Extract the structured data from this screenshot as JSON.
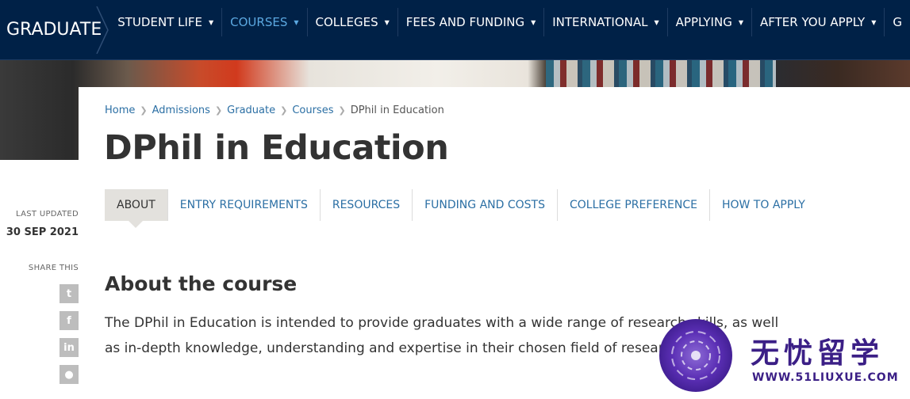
{
  "header": {
    "brand": "GRADUATE",
    "nav": [
      {
        "label": "STUDENT LIFE",
        "active": false
      },
      {
        "label": "COURSES",
        "active": true
      },
      {
        "label": "COLLEGES",
        "active": false
      },
      {
        "label": "FEES AND FUNDING",
        "active": false
      },
      {
        "label": "INTERNATIONAL",
        "active": false
      },
      {
        "label": "APPLYING",
        "active": false
      },
      {
        "label": "AFTER YOU APPLY",
        "active": false
      },
      {
        "label": "G",
        "active": false
      }
    ],
    "caret": "▼",
    "colors": {
      "background": "#002147",
      "active": "#5ba8e0"
    }
  },
  "breadcrumb": {
    "items": [
      "Home",
      "Admissions",
      "Graduate",
      "Courses"
    ],
    "current": "DPhil in Education",
    "separator": "❯"
  },
  "page_title": "DPhil in Education",
  "tabs": [
    {
      "label": "ABOUT",
      "active": true
    },
    {
      "label": "ENTRY REQUIREMENTS",
      "active": false
    },
    {
      "label": "RESOURCES",
      "active": false
    },
    {
      "label": "FUNDING AND COSTS",
      "active": false
    },
    {
      "label": "COLLEGE PREFERENCE",
      "active": false
    },
    {
      "label": "HOW TO APPLY",
      "active": false
    }
  ],
  "sidebar": {
    "last_updated_label": "LAST UPDATED",
    "last_updated_value": "30 SEP 2021",
    "share_label": "SHARE THIS",
    "share_buttons": [
      {
        "icon": "twitter-icon",
        "glyph": "t"
      },
      {
        "icon": "facebook-icon",
        "glyph": "f"
      },
      {
        "icon": "linkedin-icon",
        "glyph": "in"
      },
      {
        "icon": "reddit-icon",
        "glyph": "●"
      }
    ]
  },
  "content": {
    "heading": "About the course",
    "paragraph": "The DPhil in Education is intended to provide graduates with a wide range of research skills, as well as in-depth knowledge, understanding and expertise in their chosen field of research."
  },
  "watermark": {
    "text_cn": "无忧留学",
    "url": "WWW.51LIUXUE.COM",
    "color": "#3b1f86"
  }
}
